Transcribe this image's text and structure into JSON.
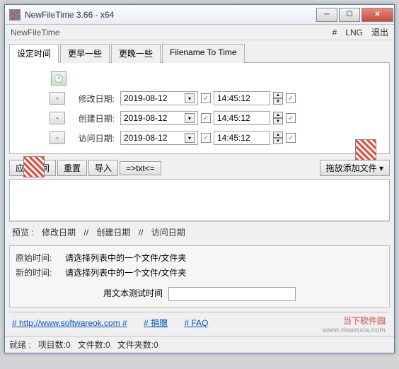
{
  "titlebar": {
    "title": "NewFileTime 3.66 - x64"
  },
  "menubar": {
    "appname": "NewFileTime",
    "hash": "#",
    "lng": "LNG",
    "exit": "退出"
  },
  "tabs": [
    {
      "label": "设定时间",
      "active": true
    },
    {
      "label": "更早一些",
      "active": false
    },
    {
      "label": "更晚一些",
      "active": false
    },
    {
      "label": "Filename To Time",
      "active": false
    }
  ],
  "dates": {
    "rows": [
      {
        "label": "修改日期:",
        "date": "2019-08-12",
        "time": "14:45:12"
      },
      {
        "label": "创建日期:",
        "date": "2019-08-12",
        "time": "14:45:12"
      },
      {
        "label": "访问日期:",
        "date": "2019-08-12",
        "time": "14:45:12"
      }
    ],
    "mini": "-"
  },
  "toolbar2": {
    "apply": "应用时间",
    "reset": "重置",
    "import": "导入",
    "txt": "=>txt<=",
    "dragdrop": "拖放添加文件"
  },
  "preview": {
    "title": "预览 :",
    "c1": "修改日期",
    "sep": "//",
    "c2": "创建日期",
    "c3": "访问日期"
  },
  "info": {
    "orig_label": "原始时间:",
    "orig_text": "请选择列表中的一个文件/文件夹",
    "new_label": "新的时间:",
    "new_text": "请选择列表中的一个文件/文件夹",
    "test_label": "用文本测试时间"
  },
  "footer": {
    "link1": "# http://www.softwareok.com #",
    "link2": "# 捐赠",
    "link3": "# FAQ"
  },
  "statusbar": {
    "ready": "就绪 :",
    "items": "项目数:0",
    "files": "文件数:0",
    "folders": "文件夹数:0"
  },
  "watermark": {
    "name": "当下软件园",
    "url": "www.downxia.com"
  }
}
